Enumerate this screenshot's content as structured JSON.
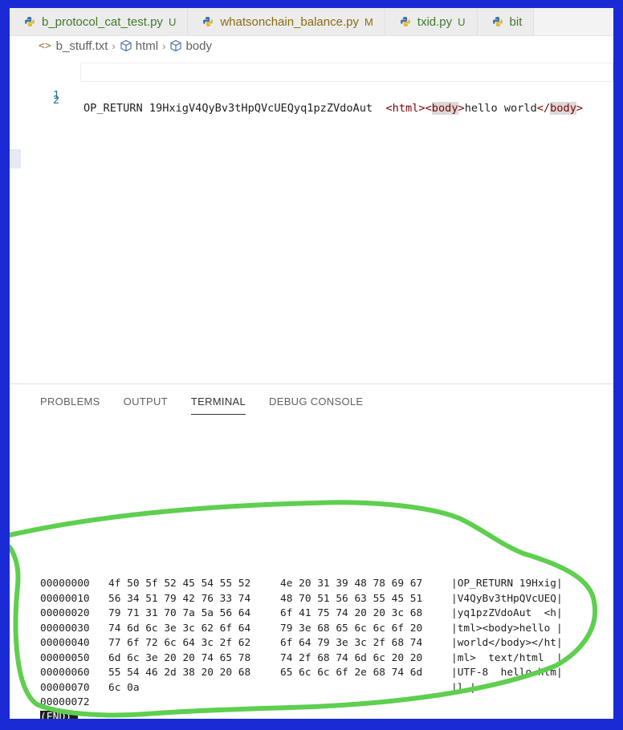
{
  "tabs": [
    {
      "label": "b_protocol_cat_test.py",
      "status": "U",
      "kind": "u"
    },
    {
      "label": "whatsonchain_balance.py",
      "status": "M",
      "kind": "m"
    },
    {
      "label": "txid.py",
      "status": "U",
      "kind": "u"
    },
    {
      "label": "bit",
      "status": "",
      "kind": "u"
    }
  ],
  "breadcrumb": {
    "file_icon": "<>",
    "file": "b_stuff.txt",
    "items": [
      "html",
      "body"
    ]
  },
  "editor": {
    "lines": [
      {
        "number": "1",
        "parts": {
          "prefix": "OP_RETURN 19HxigV4QyBv3tHpQVcUEQyq1pzZVdoAut  ",
          "lt1": "<",
          "tag1": "html",
          "gt1": ">",
          "lt2": "<",
          "tag2": "body",
          "gt2": ">",
          "text": "hello world",
          "lt3": "</",
          "tag3": "body",
          "gt3": ">"
        }
      },
      {
        "number": "2"
      }
    ]
  },
  "panel": {
    "tabs": [
      "PROBLEMS",
      "OUTPUT",
      "TERMINAL",
      "DEBUG CONSOLE"
    ],
    "active_tab": "TERMINAL"
  },
  "terminal": {
    "rows": [
      {
        "offset": "00000000",
        "hex1": "4f 50 5f 52 45 54 55 52",
        "hex2": "4e 20 31 39 48 78 69 67",
        "ascii": "|OP_RETURN 19Hxig|"
      },
      {
        "offset": "00000010",
        "hex1": "56 34 51 79 42 76 33 74",
        "hex2": "48 70 51 56 63 55 45 51",
        "ascii": "|V4QyBv3tHpQVcUEQ|"
      },
      {
        "offset": "00000020",
        "hex1": "79 71 31 70 7a 5a 56 64",
        "hex2": "6f 41 75 74 20 20 3c 68",
        "ascii": "|yq1pzZVdoAut  <h|"
      },
      {
        "offset": "00000030",
        "hex1": "74 6d 6c 3e 3c 62 6f 64",
        "hex2": "79 3e 68 65 6c 6c 6f 20",
        "ascii": "|tml><body>hello |"
      },
      {
        "offset": "00000040",
        "hex1": "77 6f 72 6c 64 3c 2f 62",
        "hex2": "6f 64 79 3e 3c 2f 68 74",
        "ascii": "|world</body></ht|"
      },
      {
        "offset": "00000050",
        "hex1": "6d 6c 3e 20 20 74 65 78",
        "hex2": "74 2f 68 74 6d 6c 20 20",
        "ascii": "|ml>  text/html  |"
      },
      {
        "offset": "00000060",
        "hex1": "55 54 46 2d 38 20 20 68",
        "hex2": "65 6c 6c 6f 2e 68 74 6d",
        "ascii": "|UTF-8  hello.htm|"
      },
      {
        "offset": "00000070",
        "hex1": "6c 0a",
        "hex2": "",
        "ascii": "|l.|"
      },
      {
        "offset": "00000072",
        "hex1": "",
        "hex2": "",
        "ascii": ""
      }
    ],
    "end_label": "(END)"
  },
  "colors": {
    "frame": "#1a2bd6",
    "annotation": "#5ecf4f",
    "tab_untracked": "#3f7a2b",
    "tab_modified": "#8a6a10"
  },
  "icons": {
    "tab_file": "python-file-icon",
    "breadcrumb_symbol": "cube-symbol-icon"
  }
}
